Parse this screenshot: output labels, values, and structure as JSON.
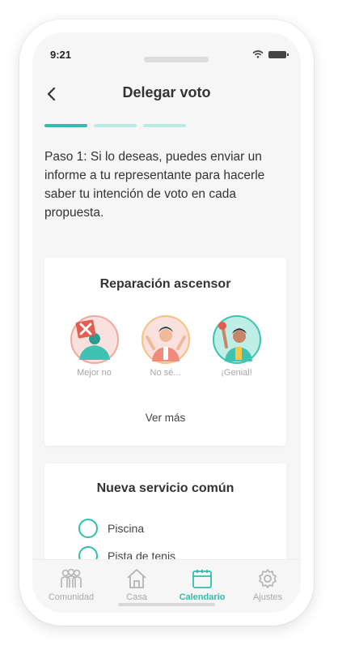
{
  "status": {
    "time": "9:21"
  },
  "header": {
    "title": "Delegar voto"
  },
  "progress": {
    "steps": 3,
    "current": 1
  },
  "intro": "Paso 1: Si lo deseas, puedes enviar un informe a tu representante para hacerle saber tu intención de voto en cada propuesta.",
  "card1": {
    "title": "Reparación ascensor",
    "options": [
      {
        "label": "Mejor no",
        "icon": "thumbs-down-avatar-icon"
      },
      {
        "label": "No sé...",
        "icon": "shrug-avatar-icon"
      },
      {
        "label": "¡Genial!",
        "icon": "thumbs-up-avatar-icon"
      }
    ],
    "more": "Ver más"
  },
  "card2": {
    "title": "Nueva servicio común",
    "options": [
      "Piscina",
      "Pista de tenis"
    ]
  },
  "tabbar": {
    "items": [
      {
        "label": "Comunidad",
        "icon": "people-icon"
      },
      {
        "label": "Casa",
        "icon": "house-icon"
      },
      {
        "label": "Calendario",
        "icon": "calendar-icon",
        "active": true
      },
      {
        "label": "Ajustes",
        "icon": "gear-icon"
      }
    ]
  },
  "colors": {
    "accent": "#2ebfae",
    "accent_light": "#b9ebe5",
    "muted": "#a9a9a9"
  }
}
